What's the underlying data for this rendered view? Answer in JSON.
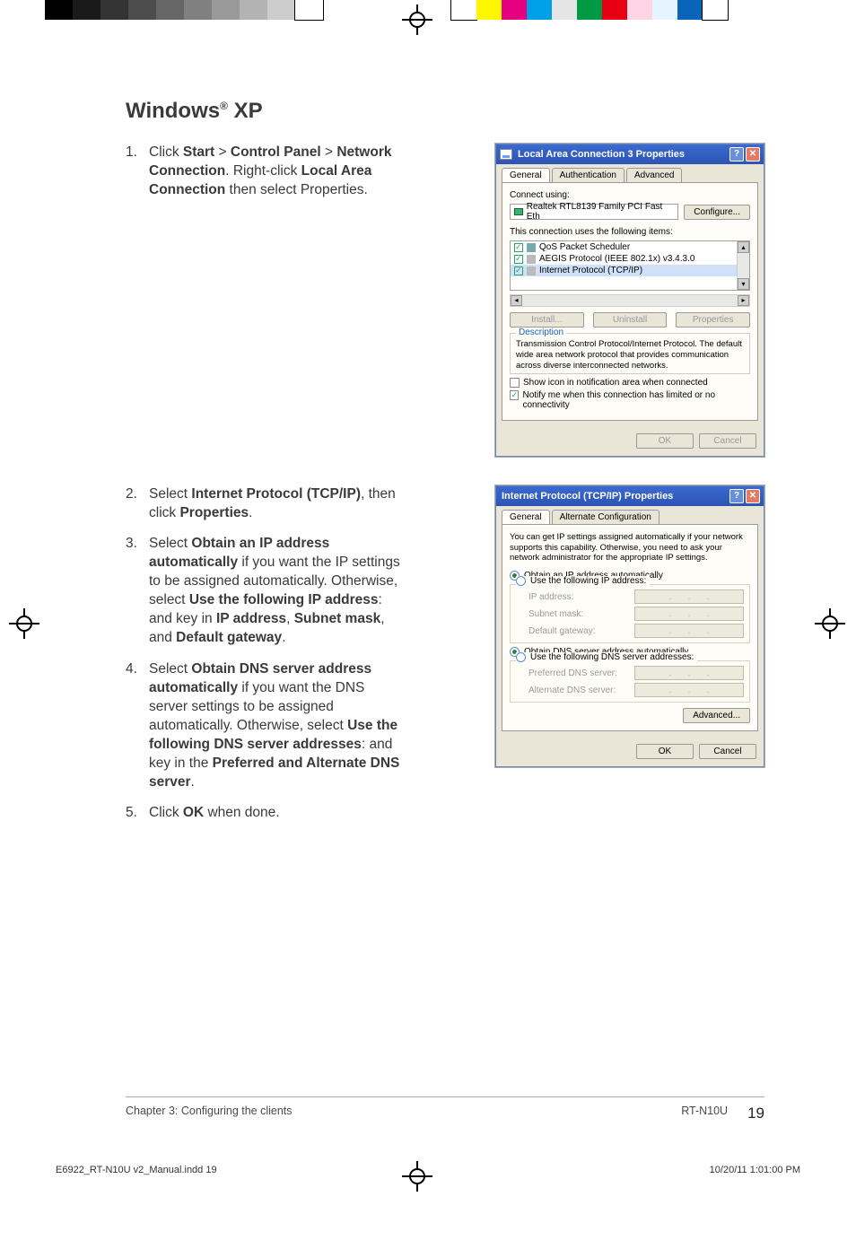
{
  "registration": {
    "left_colors": [
      "#000",
      "#1a1a1a",
      "#333",
      "#4d4d4d",
      "#666",
      "#808080",
      "#999",
      "#b3b3b3",
      "#ccc",
      "#fff"
    ],
    "right_colors": [
      "#fff",
      "#fff600",
      "#e4007f",
      "#00a0e9",
      "#e5e5e5",
      "#009944",
      "#e60012",
      "#ffd4e5",
      "#e6f4ff",
      "#0a64b7",
      "#fff"
    ]
  },
  "heading": {
    "prefix": "Windows",
    "reg": "®",
    "suffix": " XP"
  },
  "step1": {
    "num": "1.",
    "t1": "Click ",
    "b1": "Start",
    "t2": " > ",
    "b2": "Control Panel",
    "t3": " > ",
    "b3": "Network Connection",
    "t4": ". Right-click ",
    "b4": "Local Area Connection",
    "t5": " then select Properties."
  },
  "step2": {
    "num": "2.",
    "t1": "Select ",
    "b1": "Internet Protocol (TCP/IP)",
    "t2": ", then click ",
    "b2": "Properties",
    "t3": "."
  },
  "step3": {
    "num": "3.",
    "t1": "Select ",
    "b1": "Obtain an IP address automatically",
    "t2": " if you want the IP settings to be assigned automatically. Otherwise, select ",
    "b2": "Use the following IP address",
    "t3": ": and key in ",
    "b3": "IP address",
    "t4": ", ",
    "b4": "Subnet mask",
    "t5": ", and ",
    "b5": "Default gateway",
    "t6": "."
  },
  "step4": {
    "num": "4.",
    "t1": "Select ",
    "b1": "Obtain DNS server address automatically",
    "t2": " if you want the DNS server settings to be assigned automatically. Otherwise, select ",
    "b2": "Use the following DNS server addresses",
    "t3": ": and key in the ",
    "b3": "Preferred and Alternate DNS server",
    "t4": "."
  },
  "step5": {
    "num": "5.",
    "t1": "Click ",
    "b1": "OK",
    "t2": " when done."
  },
  "dlg1": {
    "title": "Local Area Connection 3 Properties",
    "help": "?",
    "close": "✕",
    "tabs": {
      "general": "General",
      "auth": "Authentication",
      "adv": "Advanced"
    },
    "connect_using": "Connect using:",
    "nic": "Realtek RTL8139 Family PCI Fast Eth",
    "configure": "Configure...",
    "uses_items": "This connection uses the following items:",
    "items": {
      "qos": "QoS Packet Scheduler",
      "aegis": "AEGIS Protocol (IEEE 802.1x) v3.4.3.0",
      "tcpip": "Internet Protocol (TCP/IP)"
    },
    "install": "Install...",
    "uninstall": "Uninstall",
    "properties": "Properties",
    "desc_label": "Description",
    "desc_text": "Transmission Control Protocol/Internet Protocol. The default wide area network protocol that provides communication across diverse interconnected networks.",
    "chk1": "Show icon in notification area when connected",
    "chk2": "Notify me when this connection has limited or no connectivity",
    "ok": "OK",
    "cancel": "Cancel"
  },
  "dlg2": {
    "title": "Internet Protocol (TCP/IP) Properties",
    "help": "?",
    "close": "✕",
    "tabs": {
      "general": "General",
      "alt": "Alternate Configuration"
    },
    "intro": "You can get IP settings assigned automatically if your network supports this capability. Otherwise, you need to ask your network administrator for the appropriate IP settings.",
    "r1": "Obtain an IP address automatically",
    "r2": "Use the following IP address:",
    "ip": "IP address:",
    "mask": "Subnet mask:",
    "gw": "Default gateway:",
    "r3": "Obtain DNS server address automatically",
    "r4": "Use the following DNS server addresses:",
    "pdns": "Preferred DNS server:",
    "adns": "Alternate DNS server:",
    "advanced": "Advanced...",
    "ok": "OK",
    "cancel": "Cancel"
  },
  "footer": {
    "chapter": "Chapter 3: Configuring the clients",
    "model": "RT-N10U",
    "page": "19"
  },
  "imposition": {
    "file": "E6922_RT-N10U v2_Manual.indd   19",
    "stamp": "10/20/11   1:01:00 PM"
  }
}
